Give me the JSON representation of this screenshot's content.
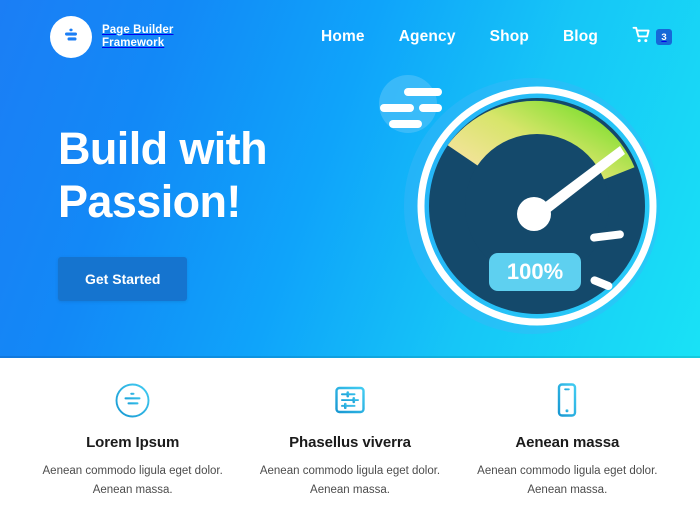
{
  "brand": {
    "name": "Page Builder\nFramework",
    "logo_icon": "sliders-circle-icon"
  },
  "nav": {
    "items": [
      {
        "label": "Home"
      },
      {
        "label": "Agency"
      },
      {
        "label": "Shop"
      },
      {
        "label": "Blog"
      }
    ],
    "cart": {
      "icon": "shopping-cart-icon",
      "count": "3"
    }
  },
  "hero": {
    "title": "Build with\nPassion!",
    "cta_label": "Get Started",
    "gradient_start": "#1b7ef5",
    "gradient_end": "#19e2f6",
    "illustration": {
      "name": "speedometer-gauge-illustration",
      "gauge_value_label": "100%",
      "gauge_face_color": "#1a4e6e",
      "gauge_ring_color": "#ffffff",
      "arc_color_start": "#f6e0a2",
      "arc_color_end": "#6edd26",
      "badge_color": "#5ed0f0",
      "needle_color": "#ffffff",
      "speed_lines_icon": "speed-lines-icon"
    }
  },
  "features": {
    "items": [
      {
        "icon": "sliders-circle-outline-icon",
        "title": "Lorem Ipsum",
        "desc": "Aenean commodo ligula eget dolor. Aenean massa."
      },
      {
        "icon": "settings-panel-icon",
        "title": "Phasellus viverra",
        "desc": "Aenean commodo ligula eget dolor. Aenean massa."
      },
      {
        "icon": "mobile-device-icon",
        "title": "Aenean massa",
        "desc": "Aenean commodo ligula eget dolor. Aenean massa."
      }
    ],
    "icon_color_start": "#18a0d8",
    "icon_color_end": "#3dc8ef"
  }
}
